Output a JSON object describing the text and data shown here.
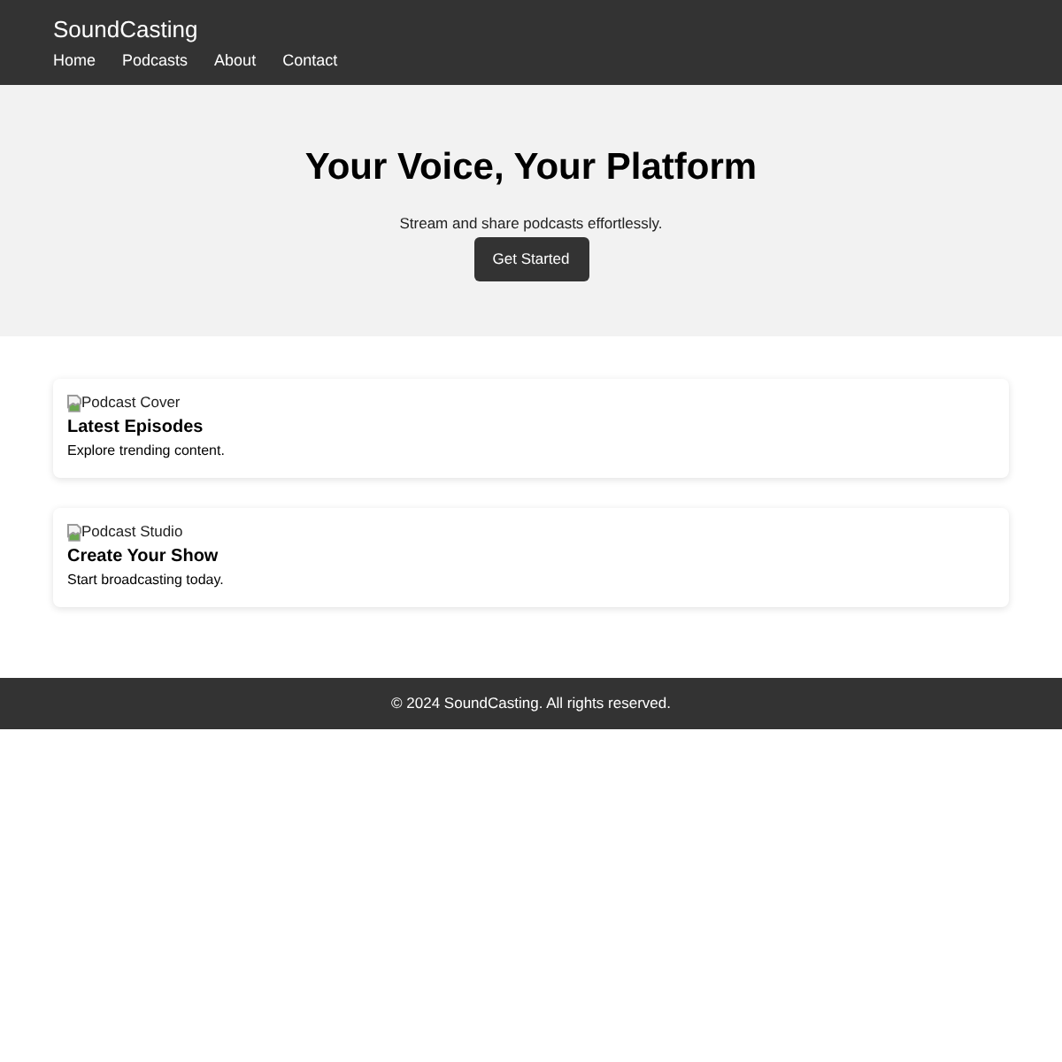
{
  "header": {
    "brand": "SoundCasting",
    "nav": [
      "Home",
      "Podcasts",
      "About",
      "Contact"
    ]
  },
  "hero": {
    "title": "Your Voice, Your Platform",
    "subtitle": "Stream and share podcasts effortlessly.",
    "button": "Get Started"
  },
  "cards": [
    {
      "image_alt": "Podcast Cover",
      "title": "Latest Episodes",
      "description": "Explore trending content."
    },
    {
      "image_alt": "Podcast Studio",
      "title": "Create Your Show",
      "description": "Start broadcasting today."
    }
  ],
  "footer": {
    "text": "© 2024 SoundCasting. All rights reserved."
  }
}
